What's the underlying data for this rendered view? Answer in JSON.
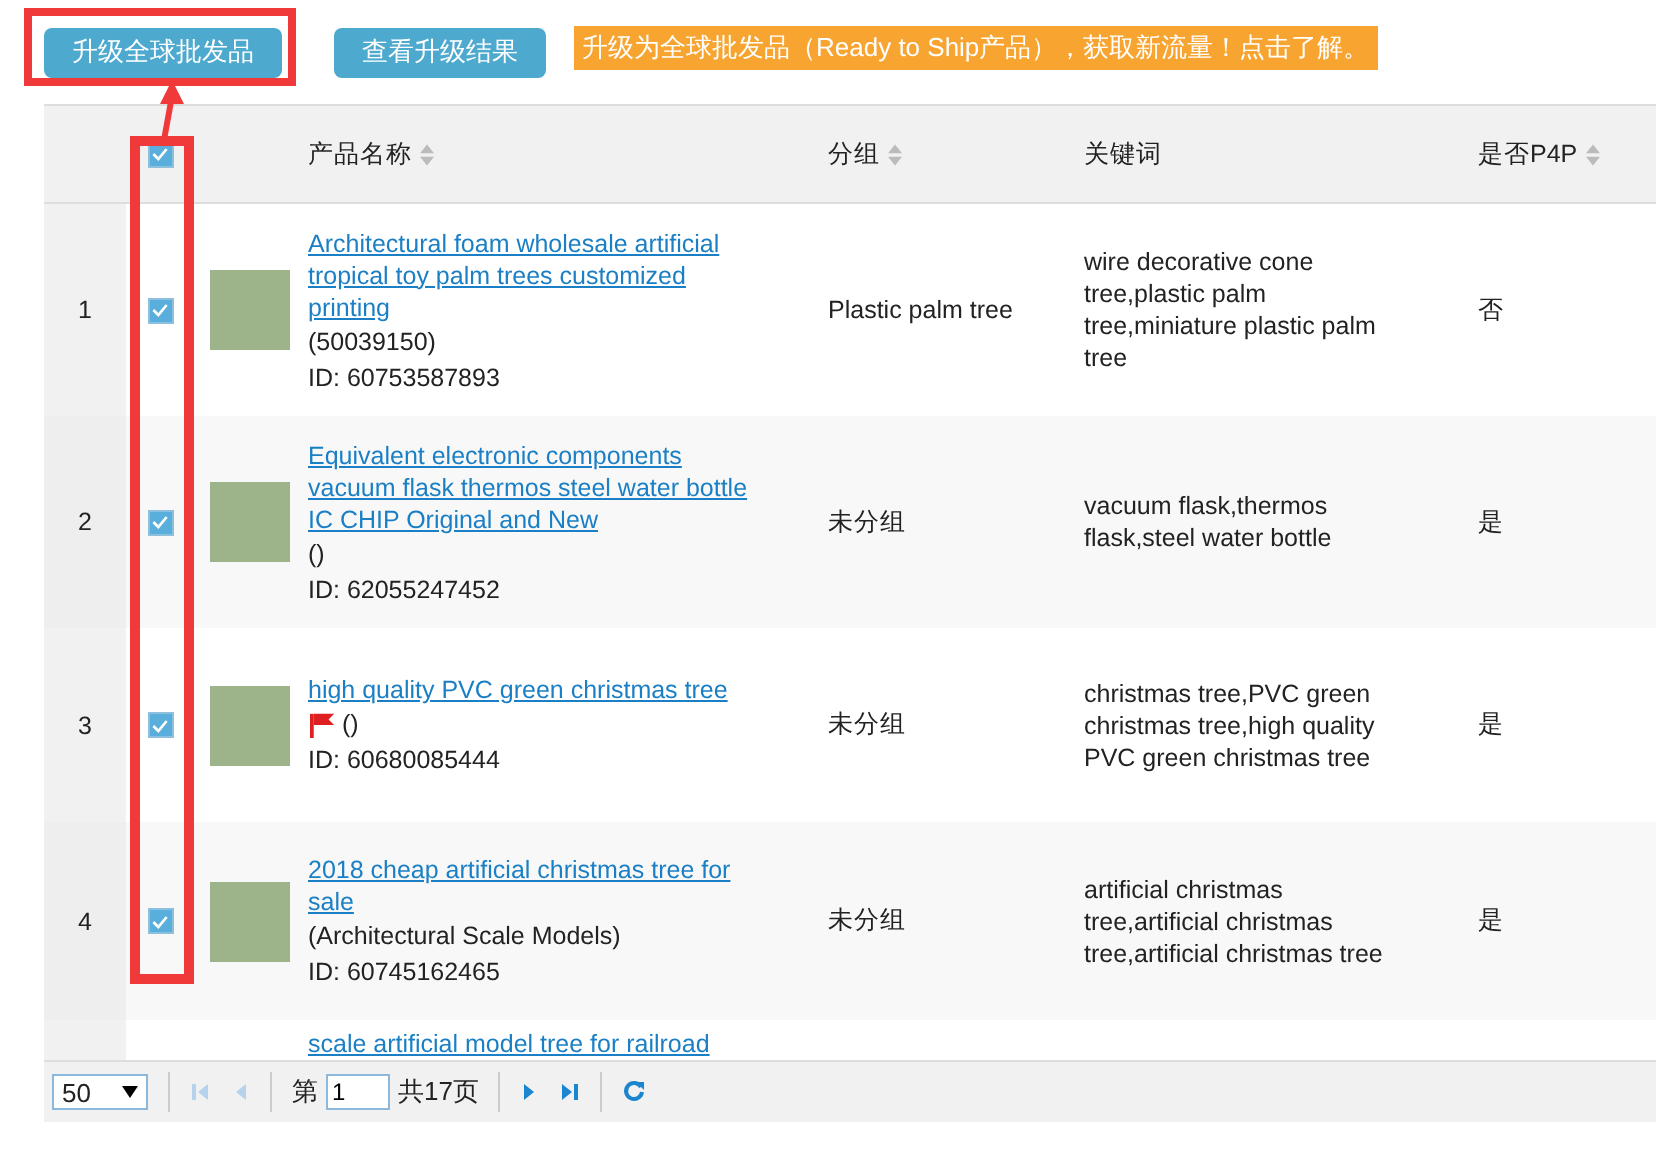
{
  "toolbar": {
    "buttons": [
      {
        "label": "升级全球批发品",
        "highlighted": true
      },
      {
        "label": "查看升级结果",
        "highlighted": false
      }
    ],
    "notice": "升级为全球批发品（Ready to Ship产品），获取新流量！点击了解。"
  },
  "table": {
    "select_all_checked": true,
    "columns": [
      {
        "label": "产品名称",
        "sortable": true
      },
      {
        "label": "分组",
        "sortable": true
      },
      {
        "label": "关键词",
        "sortable": false
      },
      {
        "label": "是否P4P",
        "sortable": true
      }
    ],
    "rows": [
      {
        "index": "1",
        "checked": true,
        "title": "Architectural foam wholesale artificial tropical toy palm trees customized printing",
        "category": "(50039150)",
        "flag": false,
        "id": "ID: 60753587893",
        "group": "Plastic palm tree",
        "keywords": "wire decorative cone tree,plastic palm tree,miniature plastic palm tree",
        "p4p": "否"
      },
      {
        "index": "2",
        "checked": true,
        "title": "Equivalent electronic components vacuum flask thermos steel water bottle IC CHIP Original and New",
        "category": "()",
        "flag": false,
        "id": "ID: 62055247452",
        "group": "未分组",
        "keywords": "vacuum flask,thermos flask,steel water bottle",
        "p4p": "是"
      },
      {
        "index": "3",
        "checked": true,
        "title": "high quality PVC green christmas tree",
        "category": "()",
        "flag": true,
        "id": "ID: 60680085444",
        "group": "未分组",
        "keywords": "christmas tree,PVC green christmas tree,high quality PVC green christmas tree",
        "p4p": "是"
      },
      {
        "index": "4",
        "checked": true,
        "title": "2018 cheap artificial christmas tree for sale",
        "category": "(Architectural Scale Models)",
        "flag": false,
        "id": "ID: 60745162465",
        "group": "未分组",
        "keywords": "artificial christmas tree,artificial christmas tree,artificial christmas tree",
        "p4p": "是"
      }
    ],
    "partial_row_title": "scale artificial model tree for railroad"
  },
  "pager": {
    "page_size": "50",
    "page_prefix": "第",
    "page": "1",
    "page_total": "共17页"
  }
}
